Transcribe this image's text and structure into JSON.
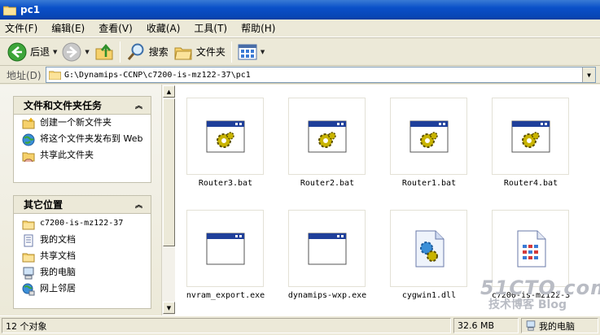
{
  "window": {
    "title": "pc1"
  },
  "menu": [
    "文件(F)",
    "编辑(E)",
    "查看(V)",
    "收藏(A)",
    "工具(T)",
    "帮助(H)"
  ],
  "toolbar": {
    "back": "后退",
    "search": "搜索",
    "folders": "文件夹"
  },
  "address": {
    "label": "地址(D)",
    "path": "G:\\Dynamips-CCNP\\c7200-is-mz122-37\\pc1"
  },
  "tasks": {
    "header": "文件和文件夹任务",
    "items": [
      {
        "icon": "new-folder-icon",
        "label": "创建一个新文件夹"
      },
      {
        "icon": "publish-web-icon",
        "label": "将这个文件夹发布到 Web"
      },
      {
        "icon": "share-folder-icon",
        "label": "共享此文件夹"
      }
    ]
  },
  "places": {
    "header": "其它位置",
    "items": [
      {
        "icon": "folder-icon",
        "label": "c7200-is-mz122-37"
      },
      {
        "icon": "my-documents-icon",
        "label": "我的文档"
      },
      {
        "icon": "shared-documents-icon",
        "label": "共享文档"
      },
      {
        "icon": "my-computer-icon",
        "label": "我的电脑"
      },
      {
        "icon": "network-places-icon",
        "label": "网上邻居"
      }
    ]
  },
  "files": [
    {
      "name": "Router3.bat",
      "icon": "batch-file-icon"
    },
    {
      "name": "Router2.bat",
      "icon": "batch-file-icon"
    },
    {
      "name": "Router1.bat",
      "icon": "batch-file-icon"
    },
    {
      "name": "Router4.bat",
      "icon": "batch-file-icon"
    },
    {
      "name": "nvram_export.exe",
      "icon": "exe-file-icon"
    },
    {
      "name": "dynamips-wxp.exe",
      "icon": "exe-file-icon"
    },
    {
      "name": "cygwin1.dll",
      "icon": "dll-file-icon"
    },
    {
      "name": "c7200-is-mz122-3",
      "icon": "image-file-icon"
    }
  ],
  "status": {
    "count": "12 个对象",
    "size": "32.6 MB",
    "location": "我的电脑"
  },
  "watermark": {
    "line1": "51CTO.com",
    "line2": "技术博客  Blog"
  }
}
